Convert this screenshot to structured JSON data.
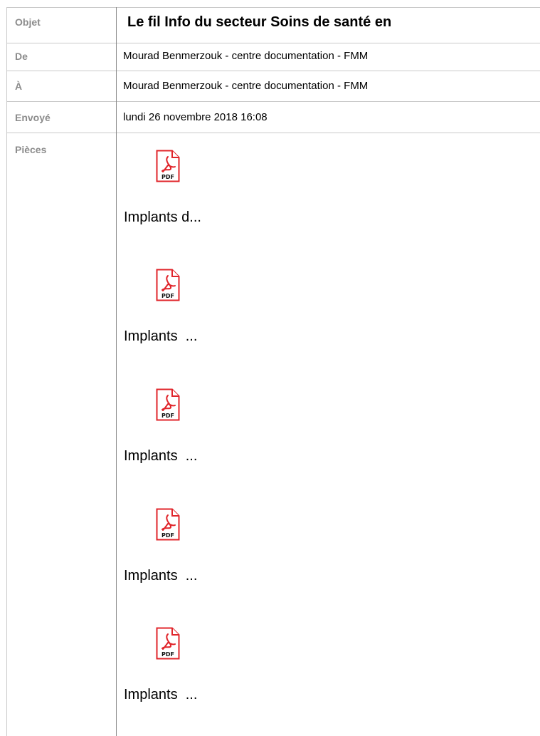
{
  "labels": {
    "subject": "Objet",
    "from": "De",
    "to": "À",
    "sent": "Envoyé",
    "attachments": "Pièces"
  },
  "values": {
    "subject": "Le fil Info du secteur Soins de santé en",
    "from": "Mourad Benmerzouk - centre documentation - FMM",
    "to": "Mourad Benmerzouk - centre documentation - FMM",
    "sent": "lundi 26 novembre 2018 16:08"
  },
  "attachments": [
    {
      "name": "Implants d...",
      "icon": "pdf-icon",
      "icon_label": "PDF"
    },
    {
      "name": "Implants  ...",
      "icon": "pdf-icon",
      "icon_label": "PDF"
    },
    {
      "name": "Implants  ...",
      "icon": "pdf-icon",
      "icon_label": "PDF"
    },
    {
      "name": "Implants  ...",
      "icon": "pdf-icon",
      "icon_label": "PDF"
    },
    {
      "name": "Implants  ...",
      "icon": "pdf-icon",
      "icon_label": "PDF"
    }
  ],
  "colors": {
    "label_gray": "#8c8c8c",
    "pdf_red": "#e0242a"
  }
}
